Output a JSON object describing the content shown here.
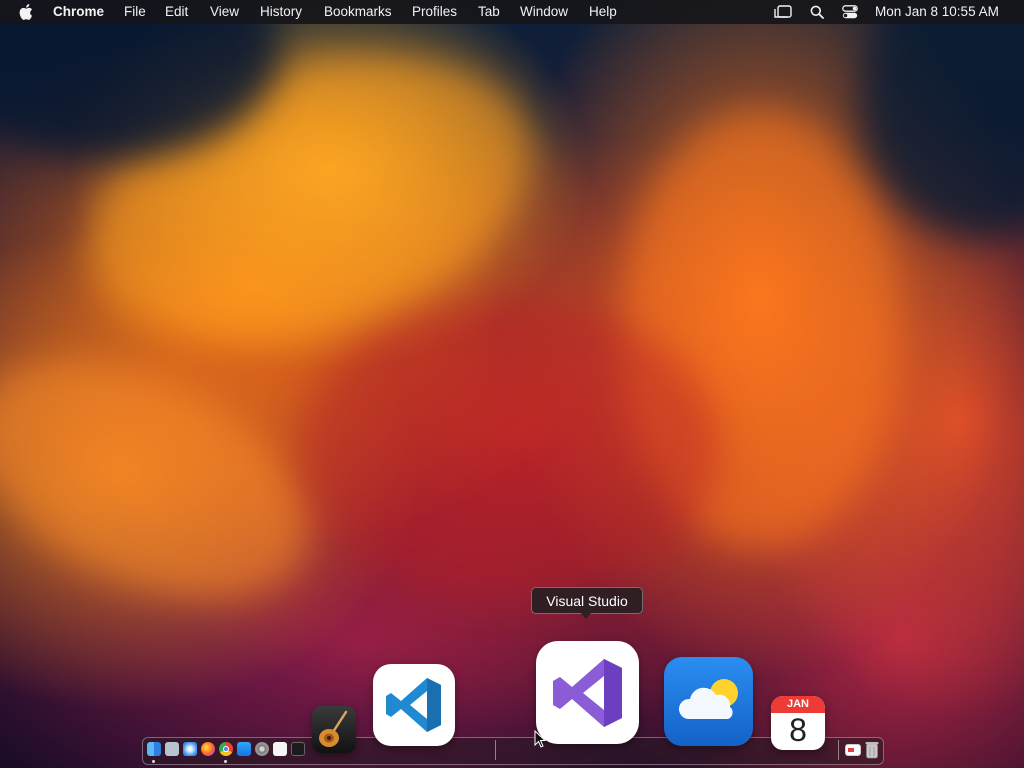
{
  "menubar": {
    "app_name": "Chrome",
    "menus": [
      "File",
      "Edit",
      "View",
      "History",
      "Bookmarks",
      "Profiles",
      "Tab",
      "Window",
      "Help"
    ],
    "clock": "Mon Jan 8  10:55 AM",
    "status_icons": [
      "stage-manager-icon",
      "search-icon",
      "control-center-icon"
    ]
  },
  "dock": {
    "tooltip": "Visual Studio",
    "calendar": {
      "month": "JAN",
      "day": "8"
    },
    "apps": [
      "finder",
      "launchpad",
      "safari",
      "firefox",
      "chrome",
      "app-store",
      "system-preferences",
      "textedit",
      "terminal",
      "garageband",
      "visual-studio-code",
      "visual-studio",
      "weather",
      "calendar",
      "preview",
      "trash"
    ]
  },
  "colors": {
    "vscode_blue": "#1f8ad2",
    "visual_studio_purple": "#8a5cd6",
    "weather_blue": "#1c7be0"
  }
}
